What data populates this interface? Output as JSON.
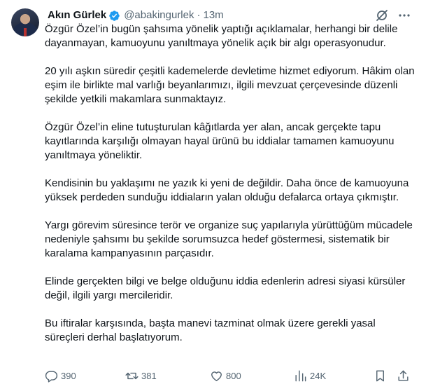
{
  "author": {
    "display_name": "Akın Gürlek",
    "handle": "@abakingurlek",
    "separator": "·",
    "time": "13m"
  },
  "icons": {
    "verified": "verified-badge-icon",
    "grok": "grok-icon",
    "more": "more-options-icon",
    "reply": "reply-icon",
    "retweet": "retweet-icon",
    "like": "like-icon",
    "views": "views-icon",
    "bookmark": "bookmark-icon",
    "share": "share-icon"
  },
  "colors": {
    "verified": "#1d9bf0",
    "text": "#0f1419",
    "muted": "#536471"
  },
  "tweet": {
    "paragraphs": [
      "Özgür Özel’in bugün şahsıma yönelik yaptığı açıklamalar, herhangi bir delile dayanmayan, kamuoyunu yanıltmaya yönelik açık bir algı operasyonudur.",
      "20 yılı aşkın süredir çeşitli kademelerde devletime hizmet ediyorum. Hâkim olan eşim ile birlikte mal varlığı beyanlarımızı, ilgili mevzuat çerçevesinde düzenli şekilde yetkili makamlara sunmaktayız.",
      "Özgür Özel’in eline tutuşturulan kâğıtlarda yer alan, ancak gerçekte tapu kayıtlarında karşılığı olmayan hayal ürünü bu iddialar tamamen kamuoyunu yanıltmaya yöneliktir.",
      "Kendisinin bu yaklaşımı ne yazık ki yeni de değildir. Daha önce de kamuoyuna yüksek perdeden sunduğu iddiaların yalan olduğu defalarca ortaya çıkmıştır.",
      "Yargı görevim süresince terör ve organize suç yapılarıyla yürüttüğüm mücadele nedeniyle şahsımı bu şekilde sorumsuzca hedef göstermesi, sistematik bir karalama kampanyasının parçasıdır.",
      "Elinde gerçekten bilgi ve belge olduğunu iddia edenlerin adresi siyasi kürsüler değil, ilgili yargı mercileridir.",
      "Bu iftiralar karşısında, başta manevi tazminat olmak üzere gerekli yasal süreçleri derhal başlatıyorum."
    ]
  },
  "stats": {
    "replies": "390",
    "retweets": "381",
    "likes": "800",
    "views": "24K"
  }
}
